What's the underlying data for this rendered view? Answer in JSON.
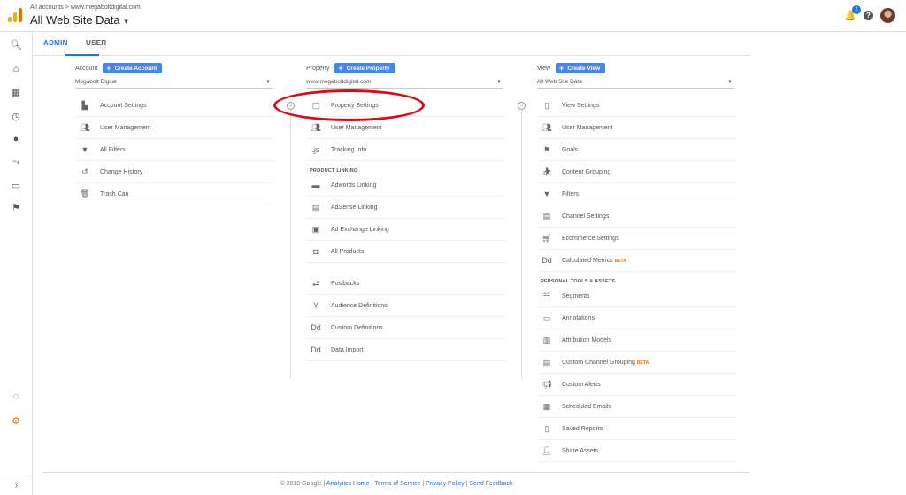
{
  "header": {
    "breadcrumb": "All accounts > www.megaboltdigital.com",
    "title": "All Web Site Data",
    "notification_count": "2"
  },
  "tabs": [
    "ADMIN",
    "USER"
  ],
  "account": {
    "label": "Account",
    "create": "Create Account",
    "selected": "Megabolt Digital",
    "items": [
      "Account Settings",
      "User Management",
      "All Filters",
      "Change History",
      "Trash Can"
    ]
  },
  "property": {
    "label": "Property",
    "create": "Create Property",
    "selected": "www.megaboltdigital.com",
    "items": [
      "Property Settings",
      "User Management",
      "Tracking Info"
    ],
    "section": "PRODUCT LINKING",
    "linking": [
      "Adwords Linking",
      "AdSense Linking",
      "Ad Exchange Linking",
      "All Products"
    ],
    "more": [
      "Postbacks",
      "Audience Definitions",
      "Custom Definitions",
      "Data Import"
    ]
  },
  "view": {
    "label": "View",
    "create": "Create View",
    "selected": "All Web Site Data",
    "items": [
      "View Settings",
      "User Management",
      "Goals",
      "Content Grouping",
      "Filters",
      "Channel Settings",
      "Ecommerce Settings",
      "Calculated Metrics"
    ],
    "section": "PERSONAL TOOLS & ASSETS",
    "tools": [
      "Segments",
      "Annotations",
      "Attribution Models",
      "Custom Channel Grouping",
      "Custom Alerts",
      "Scheduled Emails",
      "Saved Reports",
      "Share Assets"
    ],
    "beta": "BETA"
  },
  "footer": {
    "copyright": "© 2018 Google",
    "sep": "|",
    "links": [
      "Analytics Home",
      "Terms of Service",
      "Privacy Policy",
      "Send Feedback"
    ]
  },
  "colors": {
    "accent": "#1a73e8",
    "button": "#4285f4",
    "annotation": "#e30613",
    "beta": "#e8710a"
  }
}
